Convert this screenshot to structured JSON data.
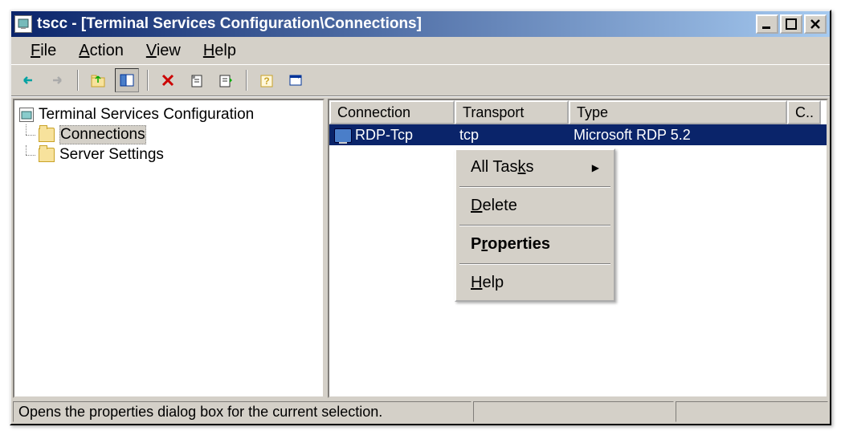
{
  "titlebar": {
    "text": "tscc - [Terminal Services Configuration\\Connections]"
  },
  "menubar": {
    "file": "File",
    "action": "Action",
    "view": "View",
    "help": "Help"
  },
  "tree": {
    "root": "Terminal Services Configuration",
    "connections": "Connections",
    "server_settings": "Server Settings"
  },
  "list": {
    "headers": {
      "connection": "Connection",
      "transport": "Transport",
      "type": "Type",
      "c": "C.."
    },
    "row": {
      "connection": "RDP-Tcp",
      "transport": "tcp",
      "type": "Microsoft RDP 5.2"
    }
  },
  "context_menu": {
    "all_tasks": "All Tasks",
    "delete": "Delete",
    "properties": "Properties",
    "help": "Help"
  },
  "statusbar": {
    "text": "Opens the properties dialog box for the current selection."
  }
}
